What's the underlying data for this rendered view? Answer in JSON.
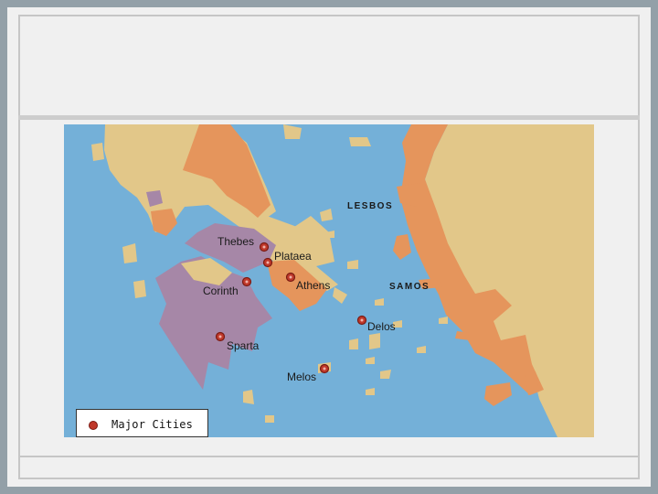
{
  "map": {
    "cities": [
      {
        "name": "Thebes"
      },
      {
        "name": "Plataea"
      },
      {
        "name": "Athens"
      },
      {
        "name": "Corinth"
      },
      {
        "name": "Sparta"
      },
      {
        "name": "Delos"
      },
      {
        "name": "Melos"
      }
    ],
    "islands": [
      {
        "name": "LESBOS"
      },
      {
        "name": "SAMOS"
      }
    ],
    "legend": {
      "label": "Major Cities"
    },
    "colors": {
      "sea": "#74b0d8",
      "land": "#e2c789",
      "orange_region": "#e5955c",
      "purple_region": "#a687a7",
      "city_marker": "#c0392b"
    }
  }
}
